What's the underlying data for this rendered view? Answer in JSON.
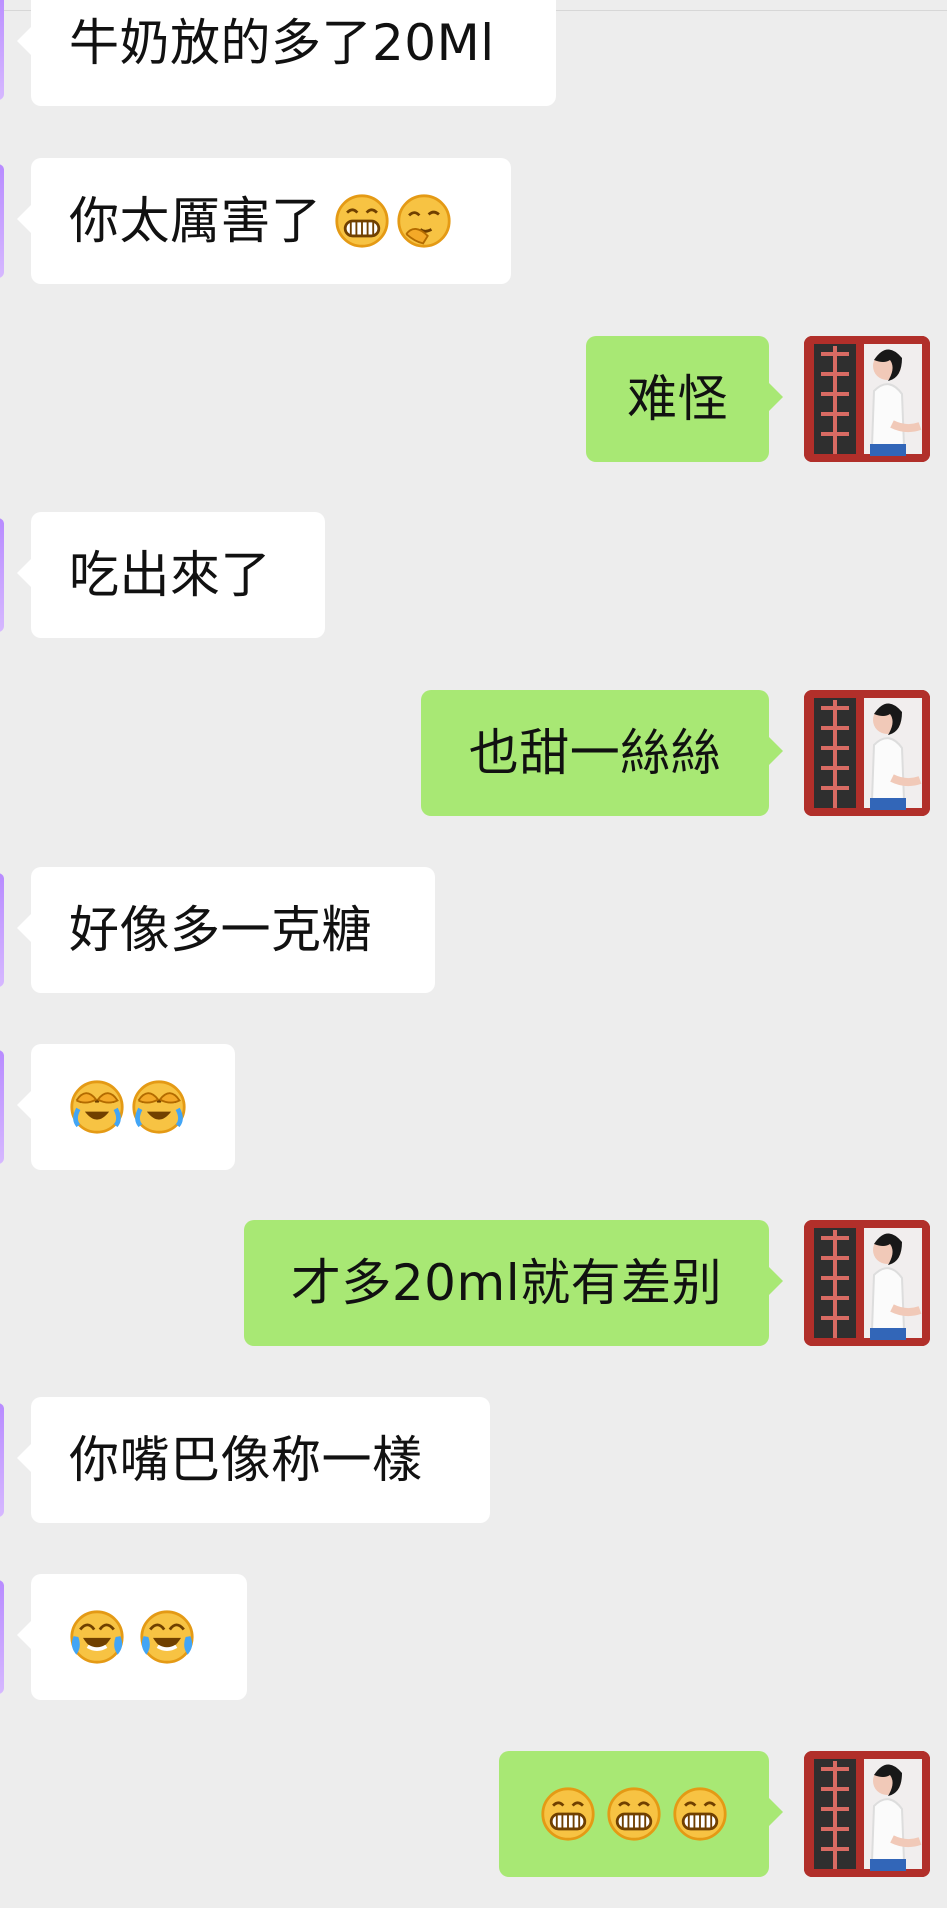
{
  "messages": [
    {
      "side": "left",
      "text": "牛奶放的多了20Ml"
    },
    {
      "side": "left",
      "text": "你太厲害了",
      "emoji": [
        "grin-face-icon",
        "thinking-face-icon"
      ]
    },
    {
      "side": "right",
      "text": "难怪"
    },
    {
      "side": "left",
      "text": "吃出來了"
    },
    {
      "side": "right",
      "text": "也甜一絲絲"
    },
    {
      "side": "left",
      "text": "好像多一克糖"
    },
    {
      "side": "left",
      "text": "",
      "emoji": [
        "facepalm-laugh-icon",
        "facepalm-laugh-icon"
      ]
    },
    {
      "side": "right",
      "text": "才多20ml就有差别"
    },
    {
      "side": "left",
      "text": "你嘴巴像称一樣"
    },
    {
      "side": "left",
      "text": "",
      "emoji": [
        "tears-of-joy-icon",
        "tears-of-joy-icon"
      ]
    },
    {
      "side": "right",
      "text": "",
      "emoji": [
        "grin-face-icon",
        "grin-face-icon",
        "grin-face-icon"
      ]
    }
  ],
  "colors": {
    "background": "#ededed",
    "left_bubble": "#ffffff",
    "right_bubble": "#a8e874",
    "avatar_frame": "#b12f2a"
  }
}
